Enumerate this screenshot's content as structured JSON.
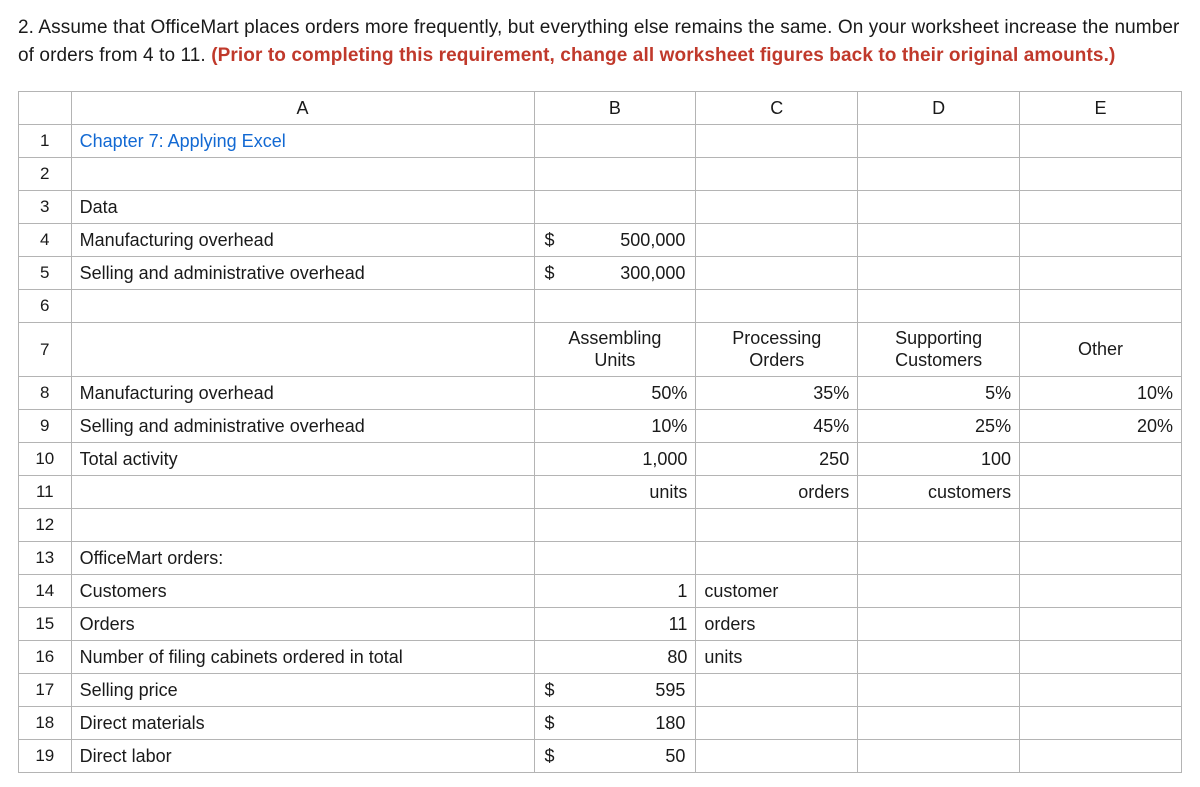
{
  "question": {
    "prefix": "2. Assume that OfficeMart places orders more frequently, but everything else remains the same. On your worksheet increase the number of orders from 4 to 11. ",
    "redText": "(Prior to completing this requirement, change all worksheet figures back to their original amounts.)"
  },
  "cols": {
    "A": "A",
    "B": "B",
    "C": "C",
    "D": "D",
    "E": "E"
  },
  "rows": {
    "r1": "1",
    "r2": "2",
    "r3": "3",
    "r4": "4",
    "r5": "5",
    "r6": "6",
    "r7": "7",
    "r8": "8",
    "r9": "9",
    "r10": "10",
    "r11": "11",
    "r12": "12",
    "r13": "13",
    "r14": "14",
    "r15": "15",
    "r16": "16",
    "r17": "17",
    "r18": "18",
    "r19": "19"
  },
  "a": {
    "title": "Chapter 7: Applying Excel",
    "dataHeader": "Data",
    "mfgOverhead": "Manufacturing overhead",
    "sellingAdmin": "Selling and administrative overhead",
    "mfgOverhead2": "Manufacturing overhead",
    "sellingAdmin2": "Selling and administrative overhead",
    "totalActivity": "Total activity",
    "officeMart": "OfficeMart orders:",
    "customers": "Customers",
    "orders": "Orders",
    "filingCabs": "Number of filing cabinets ordered in total",
    "sellingPrice": "Selling price",
    "directMaterials": "Direct materials",
    "directLabor": "Direct labor"
  },
  "vals": {
    "b4": "500,000",
    "b5": "300,000",
    "b7a": "Assembling",
    "b7b": "Units",
    "c7a": "Processing",
    "c7b": "Orders",
    "d7a": "Supporting",
    "d7b": "Customers",
    "e7": "Other",
    "b8": "50%",
    "c8": "35%",
    "d8": "5%",
    "e8": "10%",
    "b9": "10%",
    "c9": "45%",
    "d9": "25%",
    "e9": "20%",
    "b10": "1,000",
    "c10": "250",
    "d10": "100",
    "b11": "units",
    "c11": "orders",
    "d11": "customers",
    "b14": "1",
    "c14": "customer",
    "b15": "11",
    "c15": "orders",
    "b16": "80",
    "c16": "units",
    "b17": "595",
    "b18": "180",
    "b19": "50",
    "dollar": "$"
  }
}
